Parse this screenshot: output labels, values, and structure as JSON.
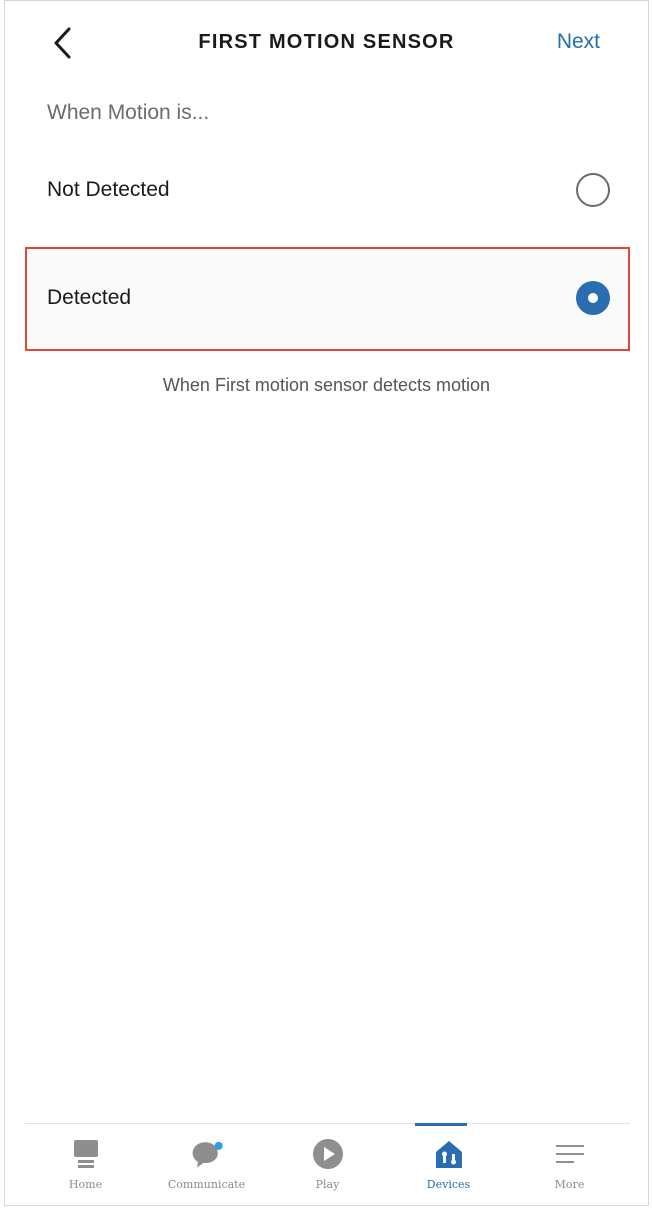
{
  "header": {
    "title": "FIRST MOTION SENSOR",
    "next_label": "Next"
  },
  "section": {
    "subheading": "When Motion is..."
  },
  "options": [
    {
      "label": "Not Detected",
      "selected": false
    },
    {
      "label": "Detected",
      "selected": true
    }
  ],
  "helper_text": "When First motion sensor detects motion",
  "tabbar": {
    "active": "Devices",
    "items": [
      {
        "label": "Home",
        "icon": "home-icon"
      },
      {
        "label": "Communicate",
        "icon": "chat-bubble-icon"
      },
      {
        "label": "Play",
        "icon": "play-icon"
      },
      {
        "label": "Devices",
        "icon": "devices-icon"
      },
      {
        "label": "More",
        "icon": "menu-icon"
      }
    ]
  },
  "colors": {
    "accent": "#2a6db0",
    "link": "#1f6fad",
    "highlight_outline": "#e0463a",
    "icon_gray": "#8e8e8e"
  }
}
